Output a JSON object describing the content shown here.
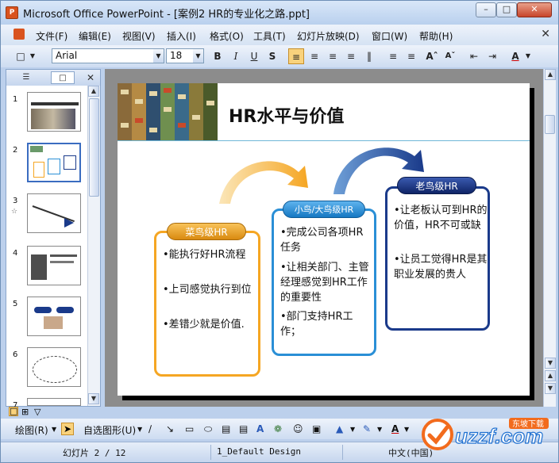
{
  "window": {
    "title": "Microsoft Office PowerPoint - [案例2 HR的专业化之路.ppt]"
  },
  "menu": [
    "文件(F)",
    "编辑(E)",
    "视图(V)",
    "插入(I)",
    "格式(O)",
    "工具(T)",
    "幻灯片放映(D)",
    "窗口(W)",
    "帮助(H)"
  ],
  "format_toolbar": {
    "font": "Arial",
    "size": "18"
  },
  "thumbnails": [
    "1",
    "2",
    "3",
    "4",
    "5",
    "6",
    "7"
  ],
  "slide": {
    "title": "HR水平与价值",
    "boxes": [
      {
        "label": "菜鸟级HR",
        "items": [
          "•能执行好HR流程",
          "•上司感觉执行到位",
          "•差错少就是价值."
        ]
      },
      {
        "label": "小鸟/大鸟级HR",
        "items": [
          "•完成公司各项HR任务",
          "•让相关部门、主管经理感觉到HR工作的重要性",
          "•部门支持HR工作；"
        ]
      },
      {
        "label": "老鸟级HR",
        "items": [
          "•让老板认可到HR的价值，HR不可或缺",
          "•让员工觉得HR是其职业发展的贵人"
        ]
      }
    ],
    "colors": {
      "rookie": "#f5a623",
      "mid": "#2a8fd6",
      "senior": "#1a3a8a"
    }
  },
  "draw_toolbar": {
    "draw": "绘图(R)",
    "autoshape": "自选图形(U)"
  },
  "status": {
    "slide": "幻灯片 2 / 12",
    "design": "1_Default Design",
    "lang": "中文(中国)"
  },
  "watermark": "uzzf.com",
  "watermark_sub": "东坡下载"
}
